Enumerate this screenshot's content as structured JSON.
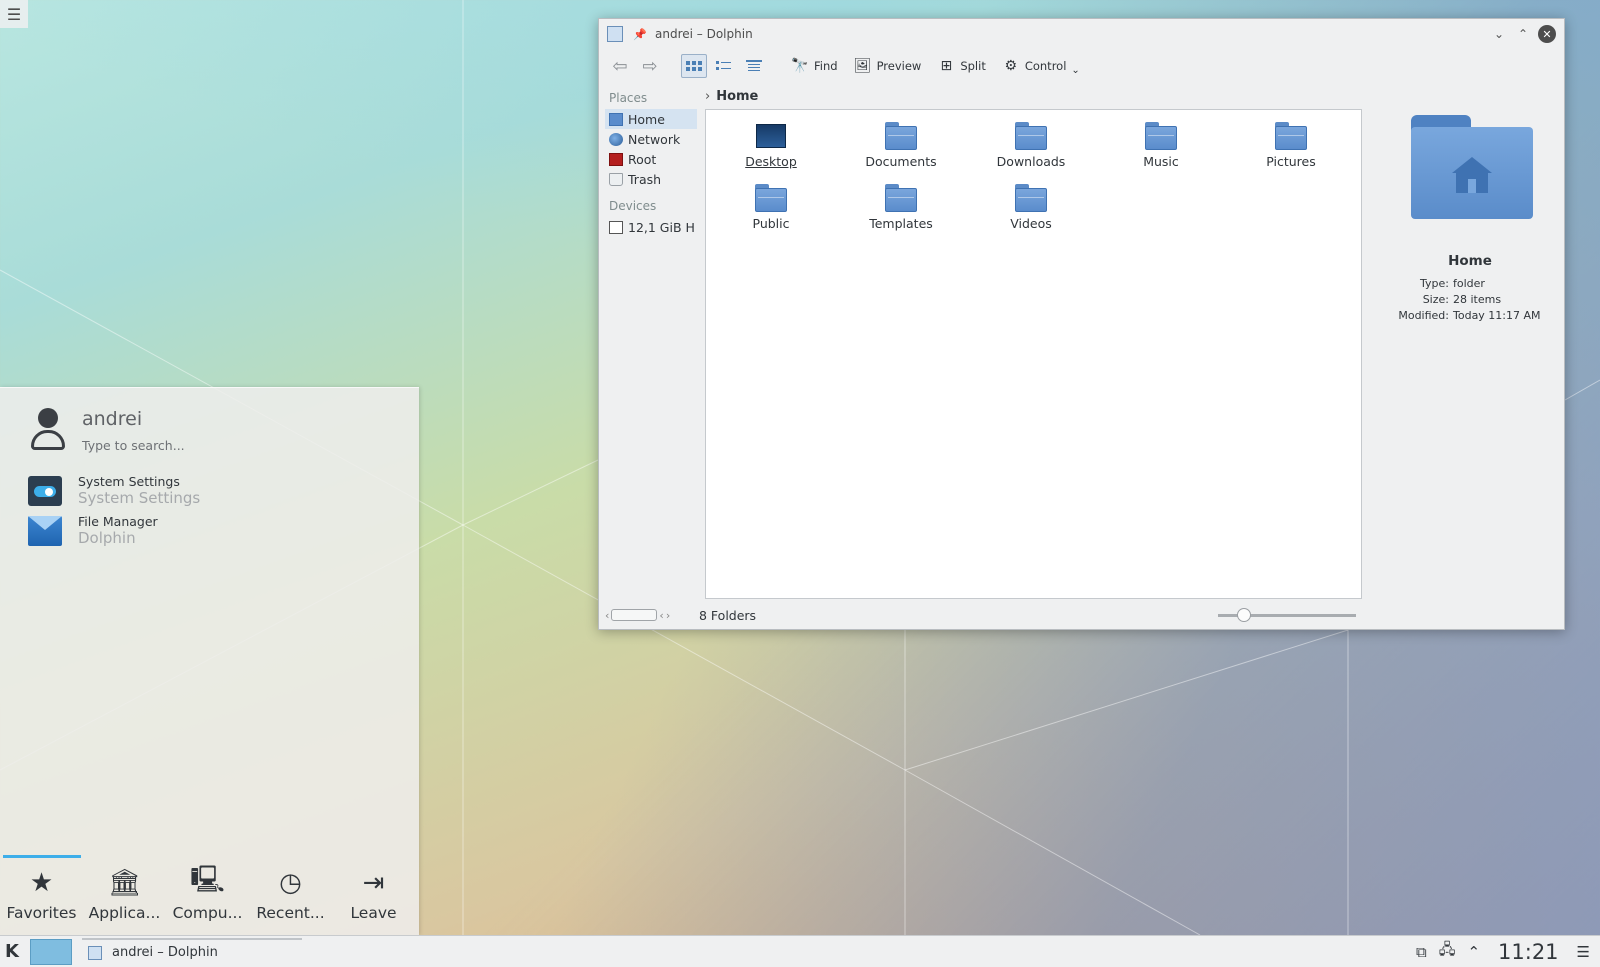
{
  "dolphin": {
    "title": "andrei – Dolphin",
    "toolbar": {
      "find": "Find",
      "preview": "Preview",
      "split": "Split",
      "control": "Control"
    },
    "places": {
      "places_title": "Places",
      "items": [
        "Home",
        "Network",
        "Root",
        "Trash"
      ],
      "devices_title": "Devices",
      "devices": [
        "12,1 GiB H"
      ]
    },
    "breadcrumb": "Home",
    "files": [
      "Desktop",
      "Documents",
      "Downloads",
      "Music",
      "Pictures",
      "Public",
      "Templates",
      "Videos"
    ],
    "status": "8 Folders",
    "zoom_level": 0.15,
    "info": {
      "title": "Home",
      "rows": [
        {
          "key": "Type:",
          "value": "folder"
        },
        {
          "key": "Size:",
          "value": "28 items"
        },
        {
          "key": "Modified:",
          "value": "Today 11:17 AM"
        }
      ]
    }
  },
  "launcher": {
    "user": "andrei",
    "search_placeholder": "Type to search...",
    "favorites": [
      {
        "name": "System Settings",
        "sub": "System Settings",
        "icon": "settings-icon"
      },
      {
        "name": "File Manager",
        "sub": "Dolphin",
        "icon": "file-manager-icon"
      }
    ],
    "tabs": [
      "Favorites",
      "Applica...",
      "Compu...",
      "Recent...",
      "Leave"
    ]
  },
  "taskbar": {
    "task": "andrei – Dolphin",
    "clock": "11:21"
  },
  "colors": {
    "accent": "#3daee9",
    "folder": "#5a8ccc",
    "selection": "#d5e3f1"
  }
}
